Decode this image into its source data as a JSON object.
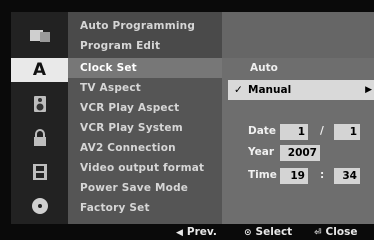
{
  "rail": {
    "items": [
      {
        "icon": "disc-menu-icon"
      },
      {
        "icon": "language-icon",
        "glyph": "A"
      },
      {
        "icon": "audio-speaker-icon"
      },
      {
        "icon": "lock-icon"
      },
      {
        "icon": "film-strip-icon"
      },
      {
        "icon": "disc-icon"
      }
    ],
    "active_index": 1
  },
  "menu": {
    "items": [
      "Auto Programming",
      "Program Edit",
      "Clock Set",
      "TV Aspect",
      "VCR Play Aspect",
      "VCR Play System",
      "AV2 Connection",
      "Video output format",
      "Power Save Mode",
      "Factory Set"
    ],
    "selected": "Clock Set"
  },
  "clock": {
    "options": {
      "auto": "Auto",
      "manual": "Manual",
      "selected": "Manual"
    },
    "date_label": "Date",
    "date_month": "1",
    "date_sep": "/",
    "date_day": "1",
    "year_label": "Year",
    "year": "2007",
    "time_label": "Time",
    "time_hour": "19",
    "time_sep": ":",
    "time_minute": "34"
  },
  "footer": {
    "prev_glyph": "◀",
    "prev": "Prev.",
    "select_glyph": "⊙",
    "select": "Select",
    "close_glyph": "⏎",
    "close": "Close"
  },
  "colors": {
    "menu_bg": "#555555",
    "menu_selected": "#777777",
    "panel_bg": "#6e6e6e",
    "highlight": "#d9d9d9",
    "rail_active": "#e9e9e9"
  }
}
